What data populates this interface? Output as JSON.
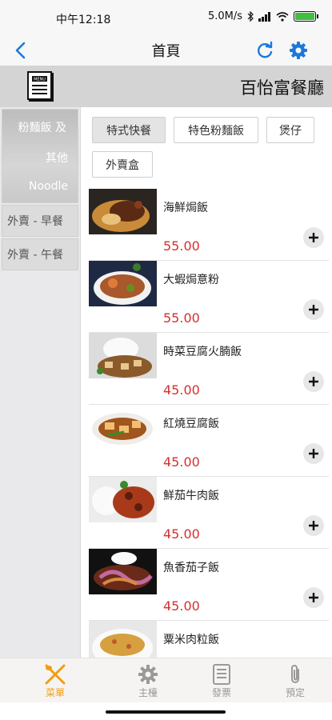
{
  "status": {
    "time": "中午12:18",
    "speed": "5.0M/s"
  },
  "nav": {
    "title": "首頁"
  },
  "header": {
    "restaurant": "百怡富餐廳",
    "menu_icon_text": "MENU"
  },
  "sidebar": {
    "items": [
      {
        "line1": "粉麵飯 及",
        "line2": "其他",
        "line3": "Noodle"
      },
      {
        "label": "外賣 - 早餐"
      },
      {
        "label": "外賣 - 午餐"
      }
    ]
  },
  "chips": [
    "特式快餐",
    "特色粉麵飯",
    "煲仔",
    "外賣盒"
  ],
  "dishes": [
    {
      "name": "海鮮焗飯",
      "price": "55.00"
    },
    {
      "name": "大蝦焗意粉",
      "price": "55.00"
    },
    {
      "name": "時菜豆腐火腩飯",
      "price": "45.00"
    },
    {
      "name": "紅燒豆腐飯",
      "price": "45.00"
    },
    {
      "name": "鮮茄牛肉飯",
      "price": "45.00"
    },
    {
      "name": "魚香茄子飯",
      "price": "45.00"
    },
    {
      "name": "粟米肉粒飯",
      "price": ""
    }
  ],
  "tabs": [
    "菜單",
    "主檯",
    "發票",
    "預定"
  ],
  "colors": {
    "accent": "#f39c12",
    "link": "#1a7ad9",
    "price": "#d32f2f"
  }
}
